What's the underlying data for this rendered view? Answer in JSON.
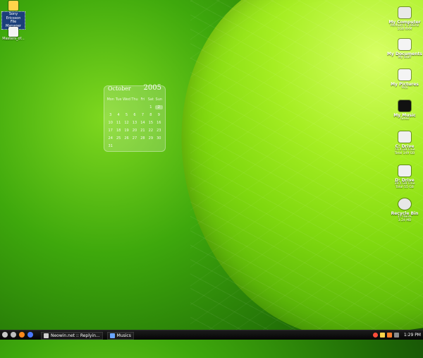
{
  "desktop": {
    "left_icons": [
      {
        "name": "sony-ericsson-file-manager",
        "label_lines": [
          "Sony",
          "Ericsson File",
          "Manager"
        ],
        "icon": "file-manager-icon"
      },
      {
        "name": "masters-shortcut",
        "label_lines": [
          "Masters_of..."
        ],
        "icon": "document-icon"
      }
    ],
    "right_icons": [
      {
        "title": "My Computer",
        "sub_lines": [
          "Pentium 4 2.8GHz",
          "1GB RAM"
        ],
        "icon": "computer-icon"
      },
      {
        "title": "My Documents",
        "sub_lines": [
          "My Stuff"
        ],
        "icon": "documents-icon"
      },
      {
        "title": "My Pictures",
        "sub_lines": [
          "Pics"
        ],
        "icon": "pictures-icon"
      },
      {
        "title": "My Music",
        "sub_lines": [
          "Tunes"
        ],
        "icon": "music-icon"
      },
      {
        "title": "C: Drive",
        "sub_lines": [
          "74.4 GB Free",
          "Total 149 GB"
        ],
        "icon": "drive-c-icon"
      },
      {
        "title": "D: Drive",
        "sub_lines": [
          "39.5 GB Free",
          "Total 55 GB"
        ],
        "icon": "drive-d-icon"
      },
      {
        "title": "Recycle Bin",
        "sub_lines": [
          "17 Items",
          "3.24 MB"
        ],
        "icon": "recycle-bin-icon"
      }
    ]
  },
  "calendar": {
    "month": "October",
    "year": "2005",
    "days_of_week": [
      "Mon",
      "Tue",
      "Wed",
      "Thu",
      "Fri",
      "Sat",
      "Sun"
    ],
    "weeks": [
      [
        "",
        "",
        "",
        "",
        "",
        "1",
        "2"
      ],
      [
        "3",
        "4",
        "5",
        "6",
        "7",
        "8",
        "9"
      ],
      [
        "10",
        "11",
        "12",
        "13",
        "14",
        "15",
        "16"
      ],
      [
        "17",
        "18",
        "19",
        "20",
        "21",
        "22",
        "23"
      ],
      [
        "24",
        "25",
        "26",
        "27",
        "28",
        "29",
        "30"
      ],
      [
        "31",
        "",
        "",
        "",
        "",
        "",
        ""
      ]
    ],
    "highlighted_day": "2"
  },
  "taskbar": {
    "quick_launch": [
      "system-icon",
      "search-icon",
      "firefox-icon",
      "ie-icon"
    ],
    "tasks": [
      {
        "label": "Neowin.net :: Replyin...",
        "icon": "browser-icon"
      },
      {
        "label": "Musics",
        "icon": "folder-icon"
      }
    ],
    "tray_icons": [
      "tray-app-1-icon",
      "tray-app-2-icon",
      "tray-app-3-icon",
      "tray-app-4-icon"
    ],
    "clock": "1:29 PM"
  }
}
